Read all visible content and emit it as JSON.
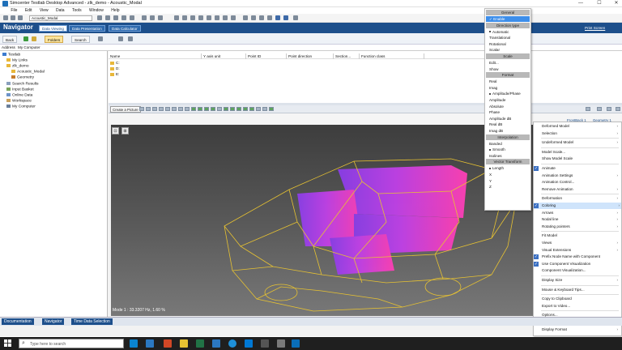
{
  "window": {
    "title": "Simcenter Testlab Desktop Advanced - zlk_demo - Acoustic_Modal",
    "controls": [
      "—",
      "☐",
      "✕"
    ]
  },
  "menu": [
    "File",
    "Edit",
    "View",
    "Data",
    "Tools",
    "Window",
    "Help"
  ],
  "toolbar": {
    "project_select": "Acoustic_Modal"
  },
  "navigator": {
    "title": "Navigator",
    "tabs": [
      "Data Viewing",
      "Data Presentation",
      "Data Calculator"
    ],
    "print_screen": "Print Screen"
  },
  "toolbar2": {
    "back": "Back",
    "folders": "Folders",
    "search": "Search"
  },
  "address": {
    "label": "Address",
    "value": "My Computer"
  },
  "tree": [
    {
      "label": "Testlab",
      "level": 0
    },
    {
      "label": "My Links",
      "level": 1
    },
    {
      "label": "zlk_demo",
      "level": 1
    },
    {
      "label": "Acoustic_Modal",
      "level": 2
    },
    {
      "label": "Geometry",
      "level": 2
    },
    {
      "label": "Search Results",
      "level": 1
    },
    {
      "label": "Input Basket",
      "level": 1
    },
    {
      "label": "Online Data",
      "level": 1
    },
    {
      "label": "Workspace",
      "level": 1
    },
    {
      "label": "My Computer",
      "level": 1
    }
  ],
  "list": {
    "columns": [
      "Name",
      "Y axis unit",
      "Point ID",
      "Point direction",
      "Section...",
      "Function class"
    ],
    "rows": [
      "C:",
      "D:",
      "E:"
    ]
  },
  "picture": {
    "create_label": "Create a Picture"
  },
  "frame_tabs": [
    "FrontBack 1",
    "Geometry 1"
  ],
  "viewport": {
    "mode_text": "Mode  1 : 33.3207 Hz, 1.60 %"
  },
  "context_menu": [
    {
      "label": "Deformed Model",
      "arrow": true
    },
    {
      "label": "Selection",
      "arrow": true
    },
    {
      "sep": true
    },
    {
      "label": "Undeformed Model",
      "arrow": true
    },
    {
      "sep": true
    },
    {
      "label": "Model Scale..."
    },
    {
      "label": "Show Model Scale"
    },
    {
      "sep": true
    },
    {
      "label": "Animate",
      "checked": true
    },
    {
      "label": "Animation Settings",
      "arrow": true
    },
    {
      "label": "Animation Control..."
    },
    {
      "label": "Remove Animation",
      "arrow": true
    },
    {
      "sep": true
    },
    {
      "label": "Deformation",
      "arrow": true
    },
    {
      "label": "Coloring",
      "arrow": true,
      "checked": true,
      "highlight": true
    },
    {
      "label": "Arrows",
      "arrow": true
    },
    {
      "label": "Nodal line",
      "arrow": true
    },
    {
      "label": "Rotating pointers",
      "arrow": true
    },
    {
      "sep": true
    },
    {
      "label": "Fit Model"
    },
    {
      "label": "Views",
      "arrow": true
    },
    {
      "label": "Visual Extensions",
      "arrow": true
    },
    {
      "label": "Prefix Node Name with Component",
      "checked": true
    },
    {
      "label": "Use Component Visualization",
      "checked": true
    },
    {
      "label": "Component Visualization..."
    },
    {
      "sep": true
    },
    {
      "label": "Display Size",
      "arrow": true
    },
    {
      "sep": true
    },
    {
      "label": "Mouse & Keyboard Tips..."
    },
    {
      "sep": true
    },
    {
      "label": "Copy to Clipboard"
    },
    {
      "label": "Export to Video..."
    },
    {
      "sep": true
    },
    {
      "label": "Options..."
    },
    {
      "label": "Legend Options..."
    },
    {
      "label": "Display Format",
      "arrow": true
    }
  ],
  "submenu": [
    {
      "header": "General"
    },
    {
      "label": "Enable",
      "selected": true,
      "checked": true
    },
    {
      "header": "Direction type"
    },
    {
      "label": "Automatic",
      "dot": true
    },
    {
      "label": "Translational"
    },
    {
      "label": "Rotational"
    },
    {
      "label": "Scalar"
    },
    {
      "header": "Scale"
    },
    {
      "label": "Edit..."
    },
    {
      "label": "Show"
    },
    {
      "header": "Format"
    },
    {
      "label": "Real"
    },
    {
      "label": "Imag"
    },
    {
      "label": "Amplitude/Phase",
      "dot": true
    },
    {
      "label": "Amplitude"
    },
    {
      "label": "Absolute"
    },
    {
      "label": "Phase"
    },
    {
      "label": "Amplitude dB"
    },
    {
      "label": "Real dB"
    },
    {
      "label": "Imag dB"
    },
    {
      "header": "Interpolation"
    },
    {
      "label": "Banded"
    },
    {
      "label": "Smooth",
      "dot": true
    },
    {
      "label": "Isolines"
    },
    {
      "header": "Vector Transform"
    },
    {
      "label": "Length",
      "dot": true
    },
    {
      "label": "X"
    },
    {
      "label": "Y"
    },
    {
      "label": "Z"
    }
  ],
  "breadcrumb": [
    "Documentation",
    "Navigator",
    "Time Data Selection"
  ],
  "taskbar": {
    "search_placeholder": "Type here to search"
  },
  "colors": {
    "nav_blue": "#1d4f8b",
    "highlight": "#cfe4fb",
    "wireframe": "#e7c232",
    "magenta": "#e040e8",
    "violet": "#8a3ee8"
  }
}
